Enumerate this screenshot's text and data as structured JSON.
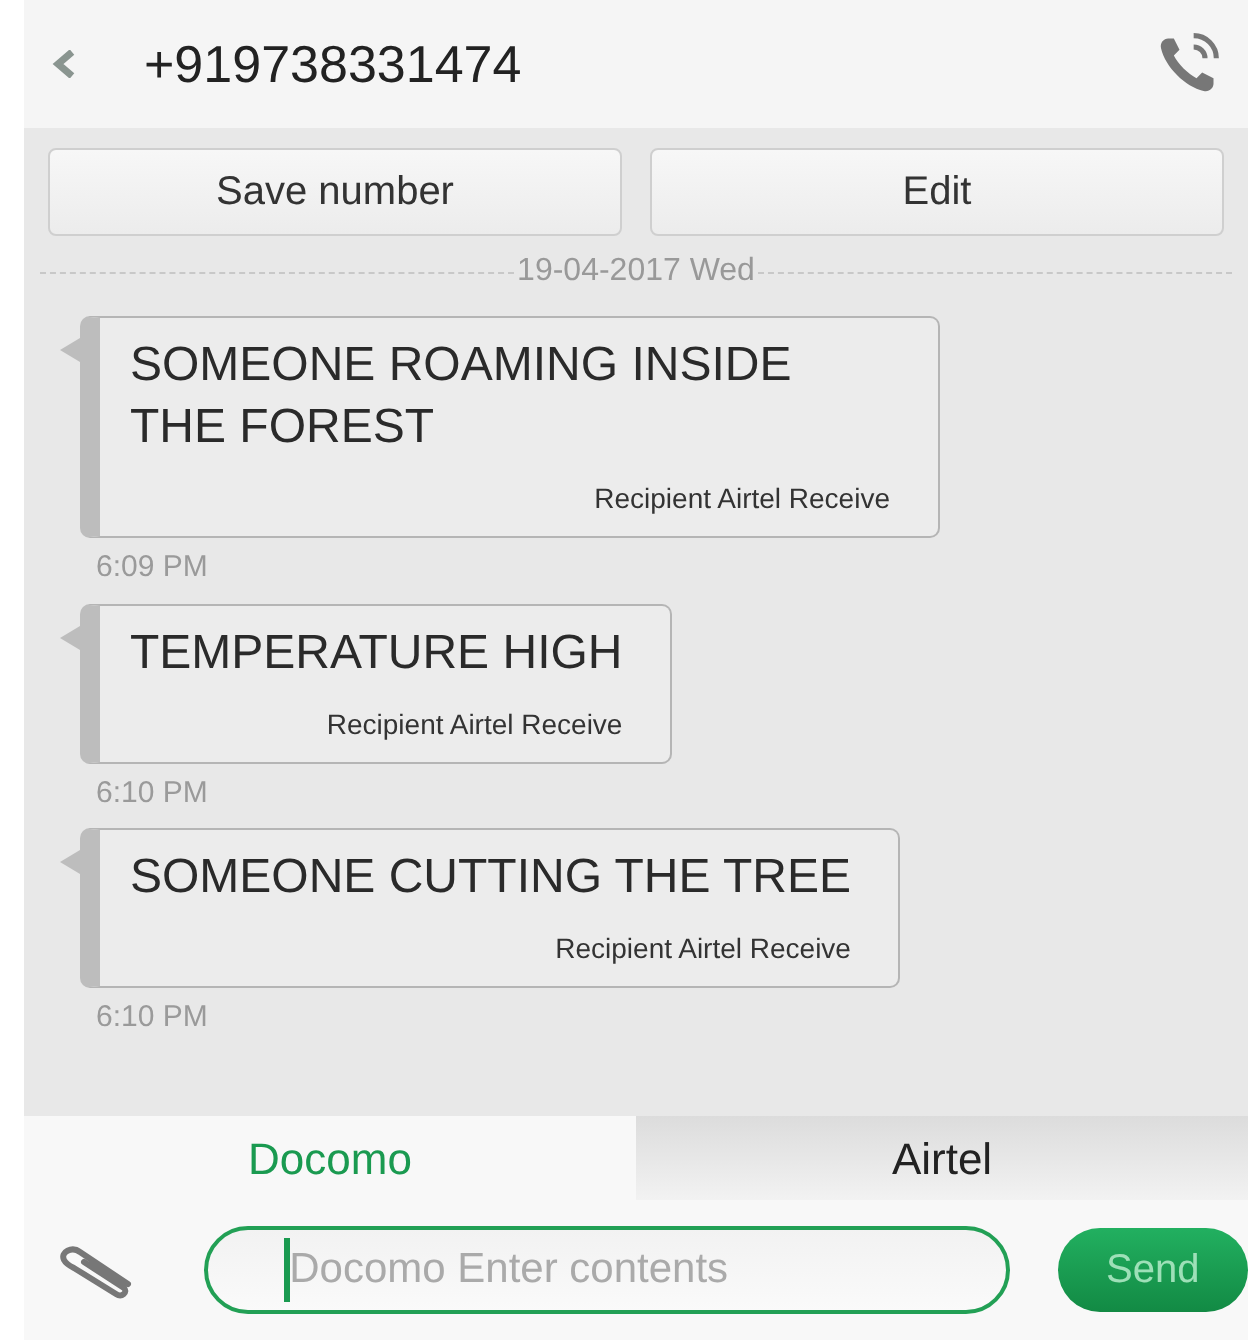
{
  "header": {
    "title": "+919738331474"
  },
  "actions": [
    "Save number",
    "Edit"
  ],
  "date_divider": "19-04-2017 Wed",
  "messages": [
    {
      "text": "SOMEONE ROAMING INSIDE THE FOREST",
      "status": "Recipient Airtel Receive",
      "time": "6:09 PM"
    },
    {
      "text": "TEMPERATURE HIGH",
      "status": "Recipient Airtel Receive",
      "time": "6:10 PM"
    },
    {
      "text": "SOMEONE CUTTING THE TREE",
      "status": "Recipient Airtel Receive",
      "time": "6:10 PM"
    }
  ],
  "sim_tabs": [
    {
      "label": "Docomo",
      "selected": true
    },
    {
      "label": "Airtel",
      "selected": false
    }
  ],
  "composer": {
    "placeholder": "Docomo Enter contents",
    "send": "Send"
  }
}
